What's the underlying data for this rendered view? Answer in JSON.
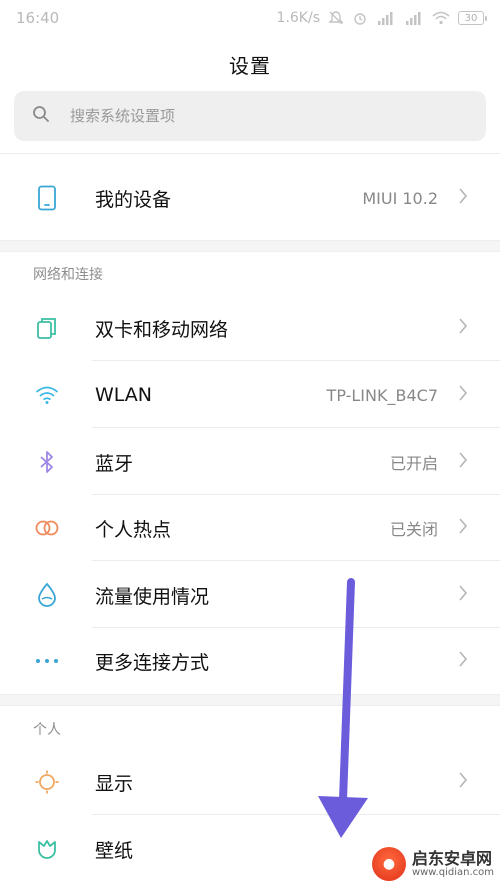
{
  "status_bar": {
    "time": "16:40",
    "net_speed": "1.6K/s",
    "battery": "30"
  },
  "header": {
    "title": "设置"
  },
  "search": {
    "placeholder": "搜索系统设置项"
  },
  "device": {
    "label": "我的设备",
    "value": "MIUI 10.2"
  },
  "sections": {
    "network": {
      "title": "网络和连接",
      "items": [
        {
          "label": "双卡和移动网络",
          "value": ""
        },
        {
          "label": "WLAN",
          "value": "TP-LINK_B4C7"
        },
        {
          "label": "蓝牙",
          "value": "已开启"
        },
        {
          "label": "个人热点",
          "value": "已关闭"
        },
        {
          "label": "流量使用情况",
          "value": ""
        },
        {
          "label": "更多连接方式",
          "value": ""
        }
      ]
    },
    "personal": {
      "title": "个人",
      "items": [
        {
          "label": "显示",
          "value": ""
        },
        {
          "label": "壁纸",
          "value": ""
        }
      ]
    }
  },
  "watermark": {
    "title": "启东安卓网",
    "url": "www.qidian.com"
  },
  "colors": {
    "sim_icon": "#3cbfa2",
    "wifi_icon": "#3bb7e6",
    "bluetooth_icon": "#9e88e6",
    "hotspot_icon": "#f08a5d",
    "data_icon": "#3aa6d6",
    "more_icon": "#3aa6d6",
    "display_icon": "#f0a860",
    "wallpaper_icon": "#3cbfa2",
    "arrow": "#6b5cdc"
  }
}
